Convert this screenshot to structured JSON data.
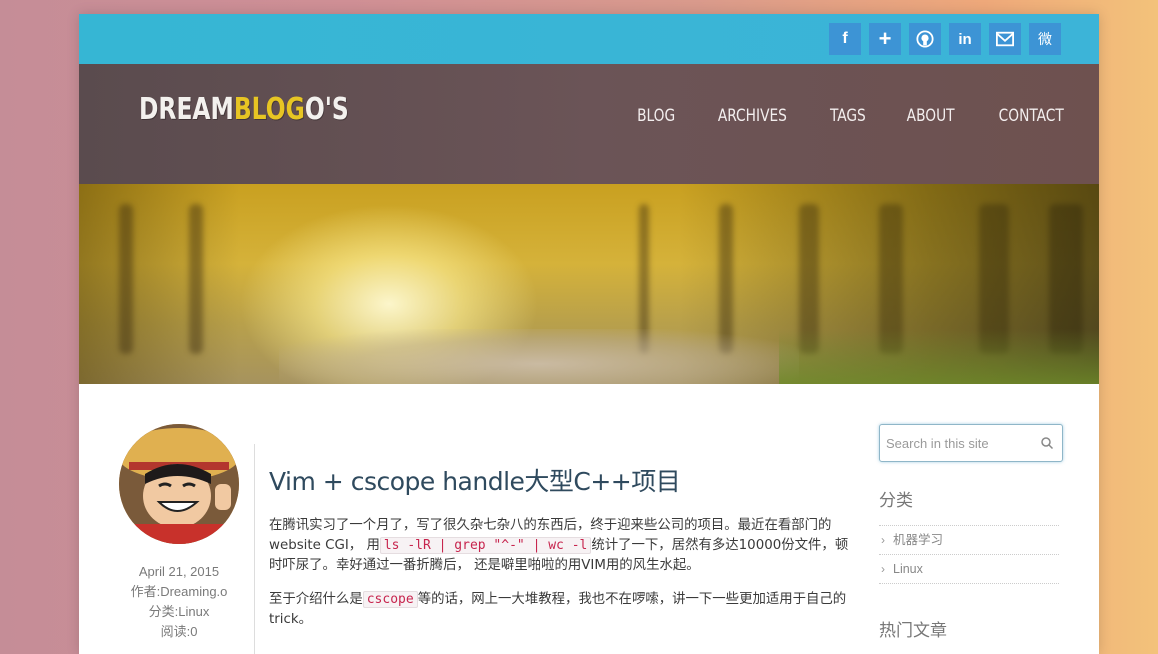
{
  "social": [
    {
      "name": "facebook-icon",
      "glyph": "f"
    },
    {
      "name": "plus-icon",
      "glyph": "+"
    },
    {
      "name": "github-icon",
      "glyph": ""
    },
    {
      "name": "linkedin-icon",
      "glyph": "in"
    },
    {
      "name": "mail-icon",
      "glyph": ""
    },
    {
      "name": "weibo-icon",
      "glyph": "微"
    }
  ],
  "header": {
    "logo_part1": "DREAM",
    "logo_accent": "BLOG",
    "logo_part2": "O'S",
    "nav": [
      "BLOG",
      "ARCHIVES",
      "TAGS",
      "ABOUT",
      "CONTACT"
    ]
  },
  "post": {
    "title": "Vim + cscope handle大型C++项目",
    "p1_a": "在腾讯实习了一个月了，写了很久杂七杂八的东西后，终于迎来些公司的项目。最近在看部门的website CGI， 用",
    "p1_code": "ls -lR | grep \"^-\" | wc -l",
    "p1_b": "统计了一下，居然有多达10000份文件，顿时吓尿了。幸好通过一番折腾后， 还是噼里啪啦的用VIM用的风生水起。",
    "p2_a": "至于介绍什么是",
    "p2_code": "cscope",
    "p2_b": "等的话，网上一大堆教程，我也不在啰嗦，讲一下一些更加适用于自己的trick。"
  },
  "meta": {
    "date": "April 21, 2015",
    "author": "作者:Dreaming.o",
    "category": "分类:Linux",
    "reads": "阅读:0"
  },
  "sidebar": {
    "search_placeholder": "Search in this site",
    "categories_title": "分类",
    "categories": [
      "机器学习",
      "Linux"
    ],
    "hot_title": "热门文章"
  },
  "colors": {
    "social_bar": "#36b6d4",
    "social_button": "#3d94d5",
    "header_bg": "#644f51",
    "logo_accent": "#e7c523",
    "title": "#2f4a5e",
    "code": "#c7254e"
  }
}
